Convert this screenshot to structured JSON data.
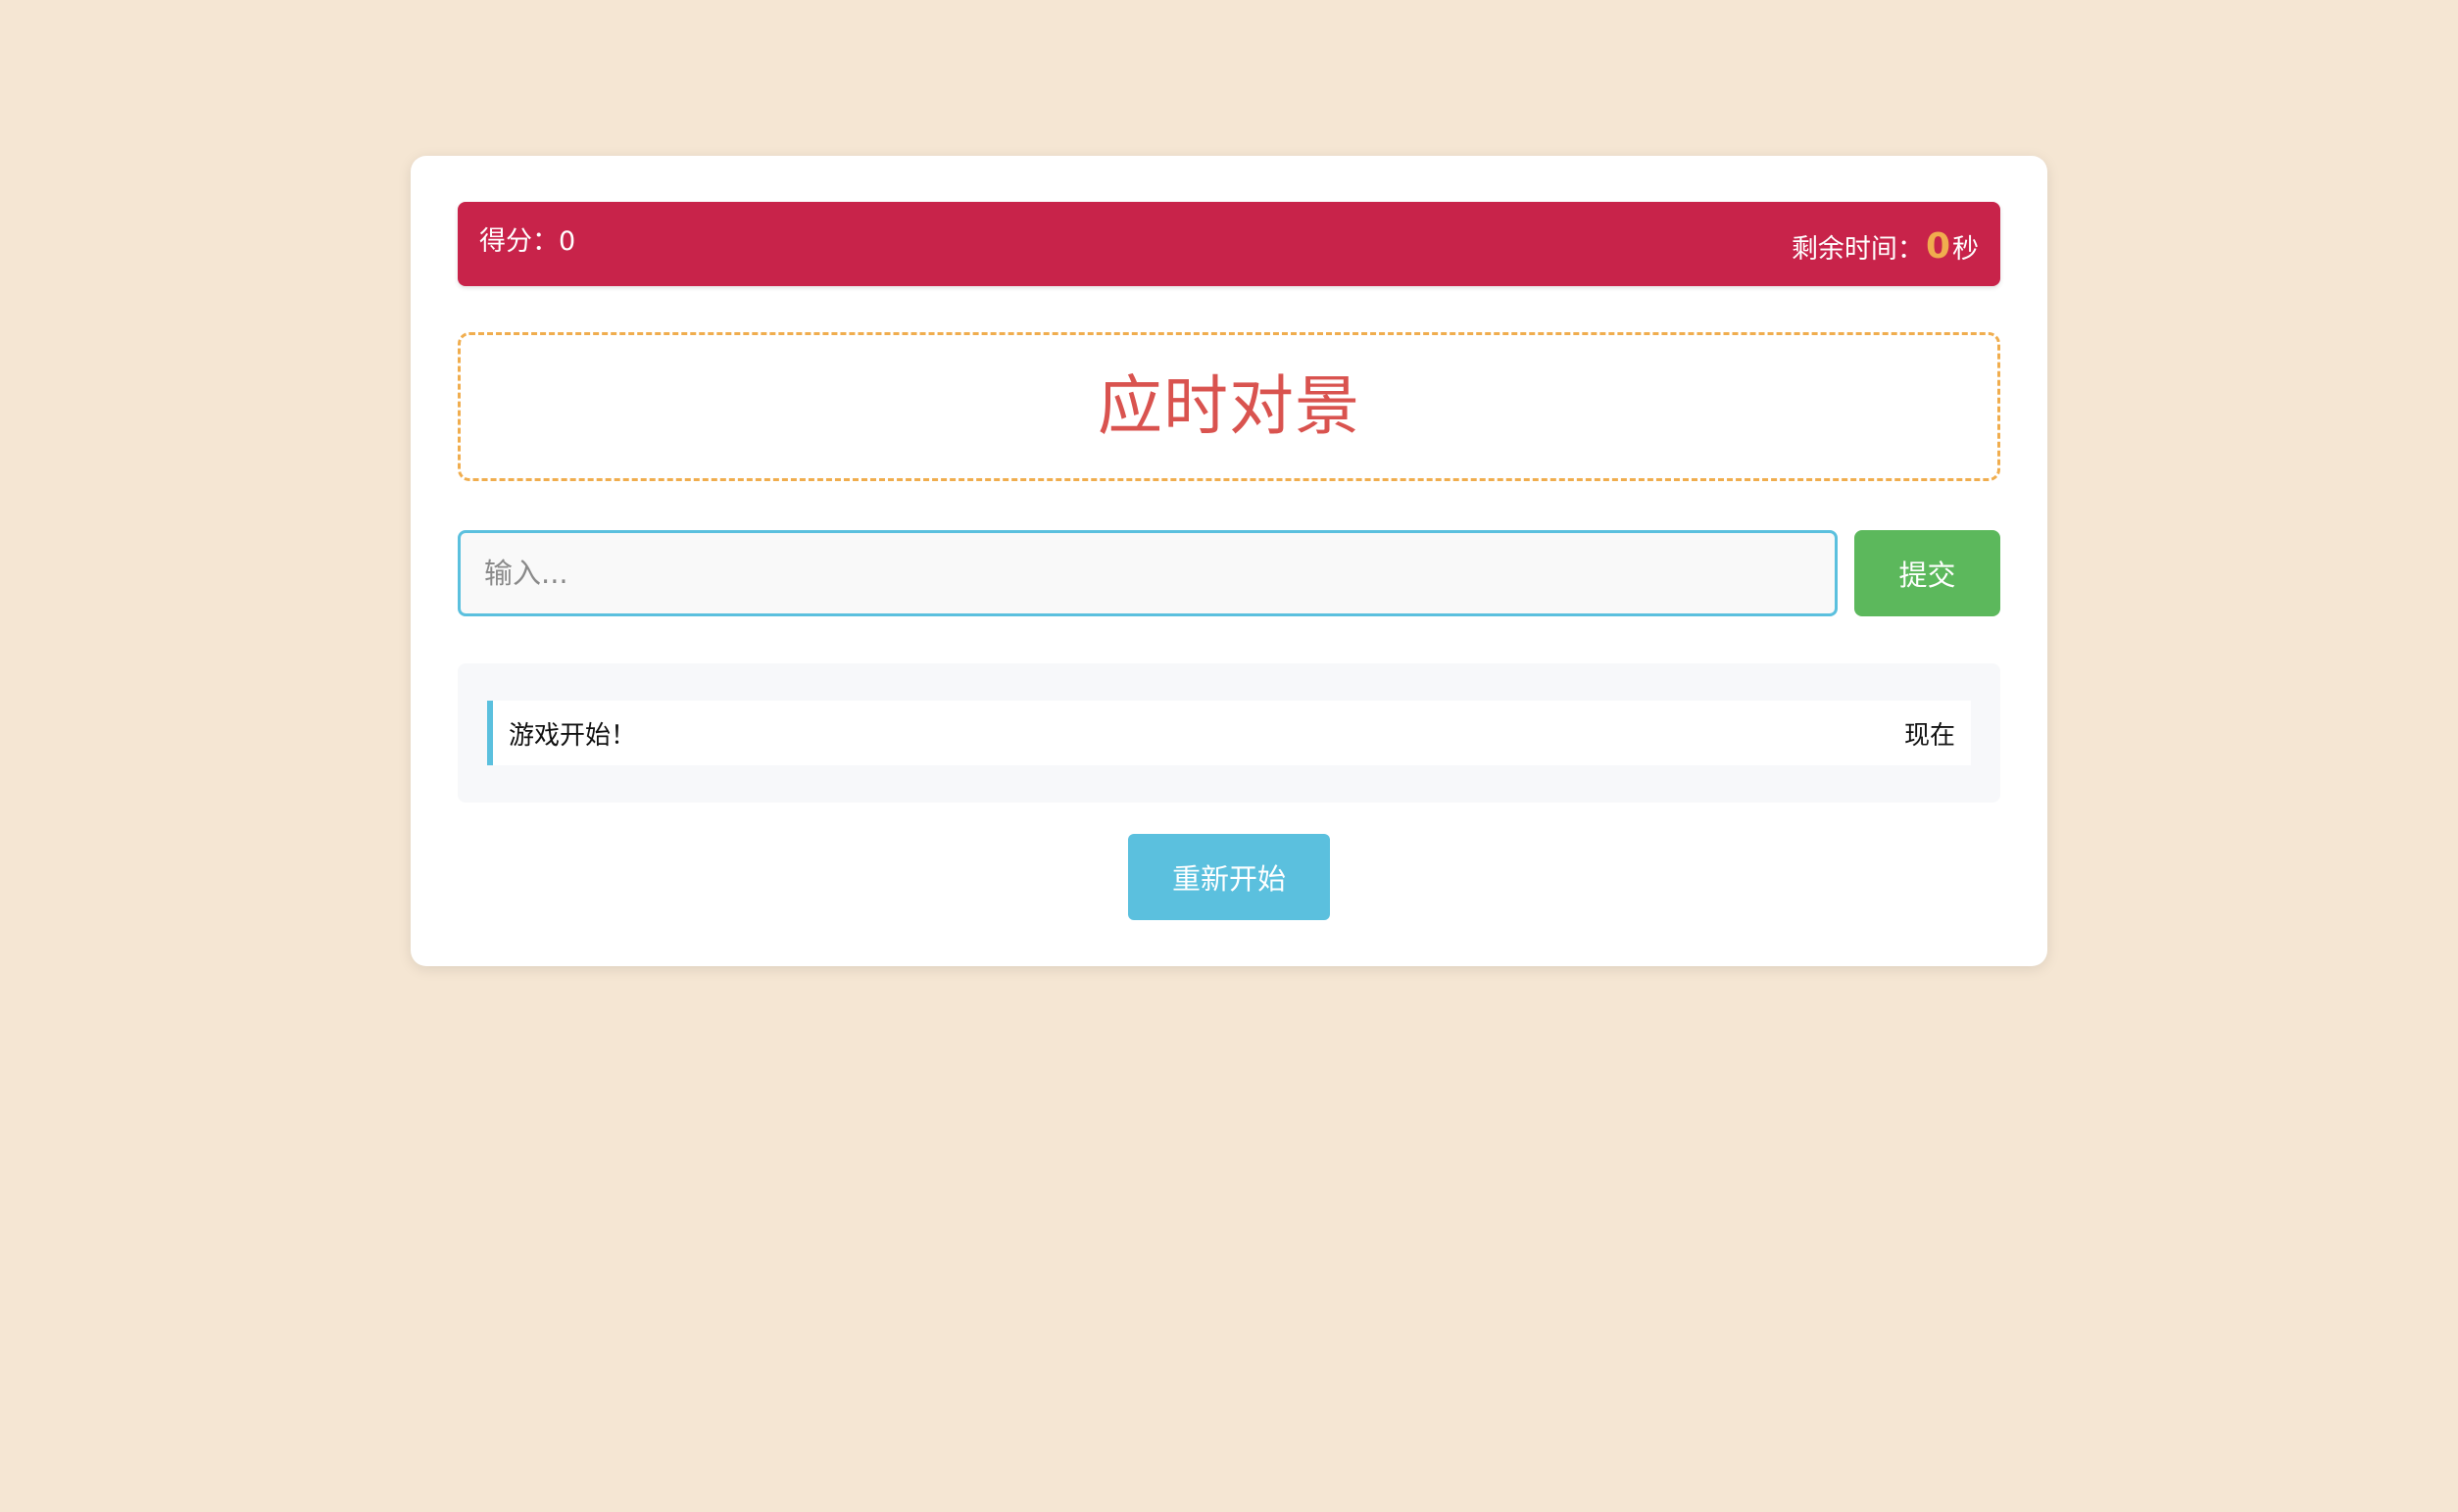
{
  "status": {
    "score_label": "得分：",
    "score_value": "0",
    "time_label": "剩余时间：",
    "time_value": "0",
    "time_unit": "秒"
  },
  "word": {
    "text": "应时对景"
  },
  "input": {
    "value": "",
    "placeholder": "输入..."
  },
  "buttons": {
    "submit_label": "提交",
    "restart_label": "重新开始"
  },
  "log": {
    "entries": [
      {
        "message": "游戏开始！",
        "time": "现在"
      }
    ]
  },
  "colors": {
    "background": "#f5e6d3",
    "status_bar": "#c8234a",
    "word_text": "#d9534f",
    "dashed_border": "#f0ad4e",
    "submit": "#5cb85c",
    "accent": "#5bc0de"
  }
}
